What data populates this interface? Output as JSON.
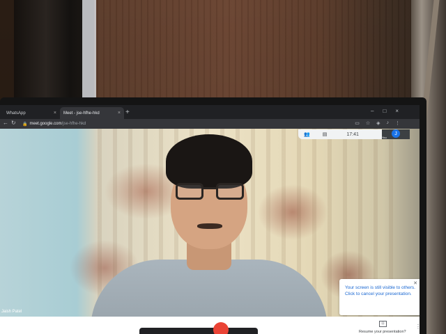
{
  "browser": {
    "tabs": [
      {
        "label": "WhatsApp"
      },
      {
        "label": "Meet - jse-hfhe-hkd"
      }
    ],
    "new_tab": "+",
    "url_domain": "meet.google.com",
    "url_path": "/jse-hfhe-hkd"
  },
  "meet": {
    "clock": "17:41",
    "avatar_initial": "J",
    "self_view_label": "You",
    "participant_name": "Jaish Patel",
    "notice": {
      "text": "Your screen is still visible to others. Click to cancel your presentation."
    },
    "resume_label": "Resume your presentation?"
  },
  "icons": {
    "close": "close-icon",
    "people": "people-icon",
    "chat": "chat-icon",
    "present": "present-icon",
    "more": "more-vert-icon"
  },
  "colors": {
    "meet_blue": "#1967d2",
    "end_call_red": "#ea4335",
    "chrome_dark": "#202124"
  }
}
